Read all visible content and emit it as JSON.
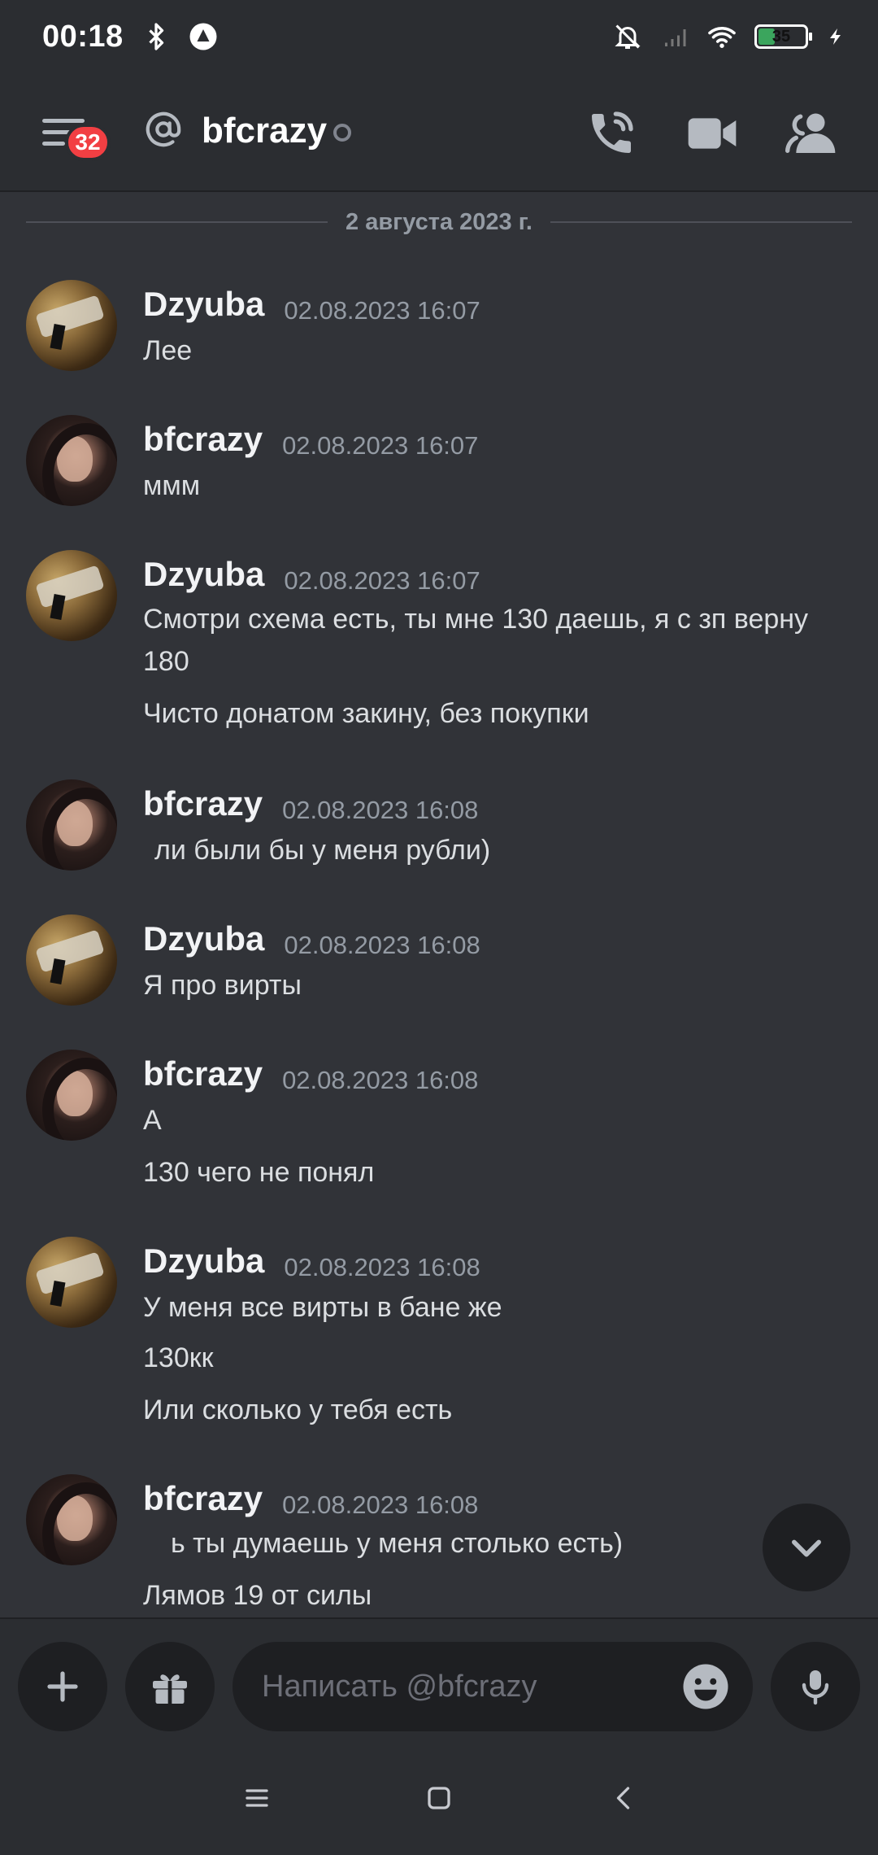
{
  "status_bar": {
    "time": "00:18",
    "battery_level": "35",
    "icons": [
      "bluetooth-icon",
      "vpn-icon",
      "mute-icon",
      "signal-icon",
      "wifi-icon",
      "battery-icon",
      "charging-icon"
    ]
  },
  "header": {
    "unread_badge": "32",
    "channel_name": "bfcrazy",
    "icons": [
      "menu-icon",
      "at-icon",
      "call-icon",
      "video-icon",
      "members-icon"
    ]
  },
  "date_divider": "2 августа 2023 г.",
  "messages": [
    {
      "author": "Dzyuba",
      "timestamp": "02.08.2023 16:07",
      "lines": [
        "Лее"
      ]
    },
    {
      "author": "bfcrazy",
      "timestamp": "02.08.2023 16:07",
      "lines": [
        "ммм"
      ]
    },
    {
      "author": "Dzyuba",
      "timestamp": "02.08.2023 16:07",
      "lines": [
        "Смотри схема есть, ты мне 130 даешь, я с зп верну",
        "180",
        "Чисто донатом закину, без покупки"
      ]
    },
    {
      "author": "bfcrazy",
      "timestamp": "02.08.2023 16:08",
      "lines": [
        "ли были бы у меня рубли)"
      ]
    },
    {
      "author": "Dzyuba",
      "timestamp": "02.08.2023 16:08",
      "lines": [
        "Я про вирты"
      ]
    },
    {
      "author": "bfcrazy",
      "timestamp": "02.08.2023 16:08",
      "lines": [
        "А",
        "130 чего не понял"
      ]
    },
    {
      "author": "Dzyuba",
      "timestamp": "02.08.2023 16:08",
      "lines": [
        "У меня все вирты в бане же",
        "130кк",
        "Или сколько у тебя есть"
      ]
    },
    {
      "author": "bfcrazy",
      "timestamp": "02.08.2023 16:08",
      "lines": [
        "ь ты думаешь у меня столько есть)",
        "Лямов 19 от силы"
      ]
    }
  ],
  "composer": {
    "placeholder": "Написать @bfcrazy",
    "icons": [
      "plus-icon",
      "gift-icon",
      "emoji-icon",
      "microphone-icon"
    ]
  },
  "colors": {
    "background": "#313338",
    "header_bg": "#2b2d31",
    "badge": "#f23f43",
    "timestamp": "#949ba4",
    "text": "#dbdee1"
  }
}
